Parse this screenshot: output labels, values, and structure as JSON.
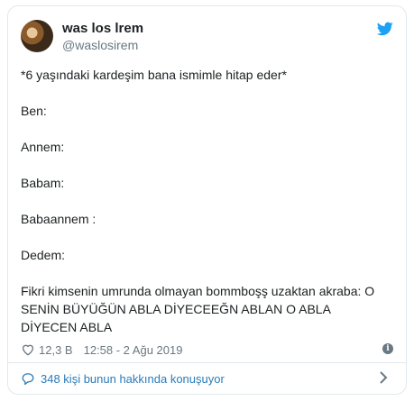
{
  "tweet": {
    "display_name": "was los lrem",
    "handle": "@waslosirem",
    "lines": [
      "*6 yaşındaki kardeşim bana ismimle hitap eder*",
      "",
      "Ben:",
      "",
      "Annem:",
      "",
      "Babam:",
      "",
      "Babaannem :",
      "",
      "Dedem:",
      "",
      "Fikri kimsenin umrunda olmayan bommboşş uzaktan akraba:  O",
      "SENİN BÜYÜĞÜN ABLA DİYECEEĞN ABLAN O ABLA",
      "DİYECEN ABLA"
    ],
    "likes": "12,3 B",
    "timestamp": "12:58 - 2 Ağu 2019",
    "info_icon": "i",
    "conversation": "348 kişi bunun hakkında konuşuyor"
  },
  "colors": {
    "brand": "#1da1f2",
    "link": "#2b7bb9",
    "muted": "#697882",
    "border": "#e1e8ed"
  },
  "icons": {
    "brand": "twitter-bird-icon",
    "like": "heart-icon",
    "info": "info-icon",
    "conversation": "speech-bubble-icon",
    "chevron": "chevron-right-icon"
  }
}
